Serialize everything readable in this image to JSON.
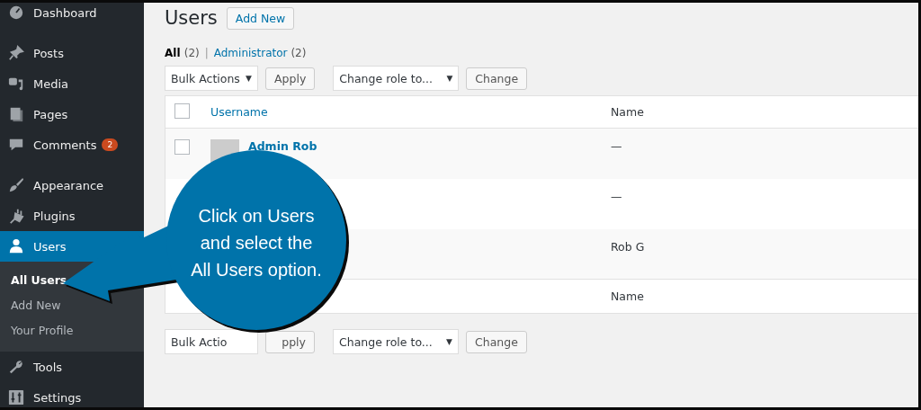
{
  "sidebar": {
    "sections": [
      [
        {
          "label": "Dashboard",
          "selected": false
        }
      ],
      [
        {
          "label": "Posts",
          "selected": false
        },
        {
          "label": "Media",
          "selected": false
        },
        {
          "label": "Pages",
          "selected": false
        },
        {
          "label": "Comments",
          "selected": false,
          "badge": "2"
        }
      ],
      [
        {
          "label": "Appearance",
          "selected": false
        },
        {
          "label": "Plugins",
          "selected": false
        },
        {
          "label": "Users",
          "selected": true,
          "children": [
            {
              "label": "All Users",
              "selected": true
            },
            {
              "label": "Add New",
              "selected": false
            },
            {
              "label": "Your Profile",
              "selected": false
            }
          ]
        },
        {
          "label": "Tools",
          "selected": false
        },
        {
          "label": "Settings",
          "selected": false
        }
      ]
    ]
  },
  "page": {
    "title": "Users",
    "add_button": "Add New"
  },
  "filter_separator": "|",
  "filters": [
    {
      "label": "All",
      "count": "(2)",
      "selected": true
    },
    {
      "label": "Administrator",
      "count": "(2)",
      "selected": false
    }
  ],
  "top_actions": {
    "bulk": "Bulk Actions",
    "bulk_caret": "▼",
    "apply": "Apply",
    "role": "Change role to...",
    "role_caret": "▼",
    "change": "Change"
  },
  "table": {
    "columns": [
      "Username",
      "Name"
    ],
    "select_all_checked": false,
    "rows": [
      {
        "username": "Admin Rob",
        "name": "—",
        "avatar": true,
        "checked": false
      },
      {
        "name": "—"
      },
      {
        "name": "Rob G"
      }
    ],
    "footer": [
      "Name"
    ]
  },
  "bottom_actions": {
    "bulk": "Bulk Actio",
    "apply": "pply",
    "role": "Change role to...",
    "role_caret": "▼",
    "change": "Change"
  },
  "callout": {
    "lines": [
      "Click on Users",
      "and select the",
      "All Users option."
    ]
  }
}
